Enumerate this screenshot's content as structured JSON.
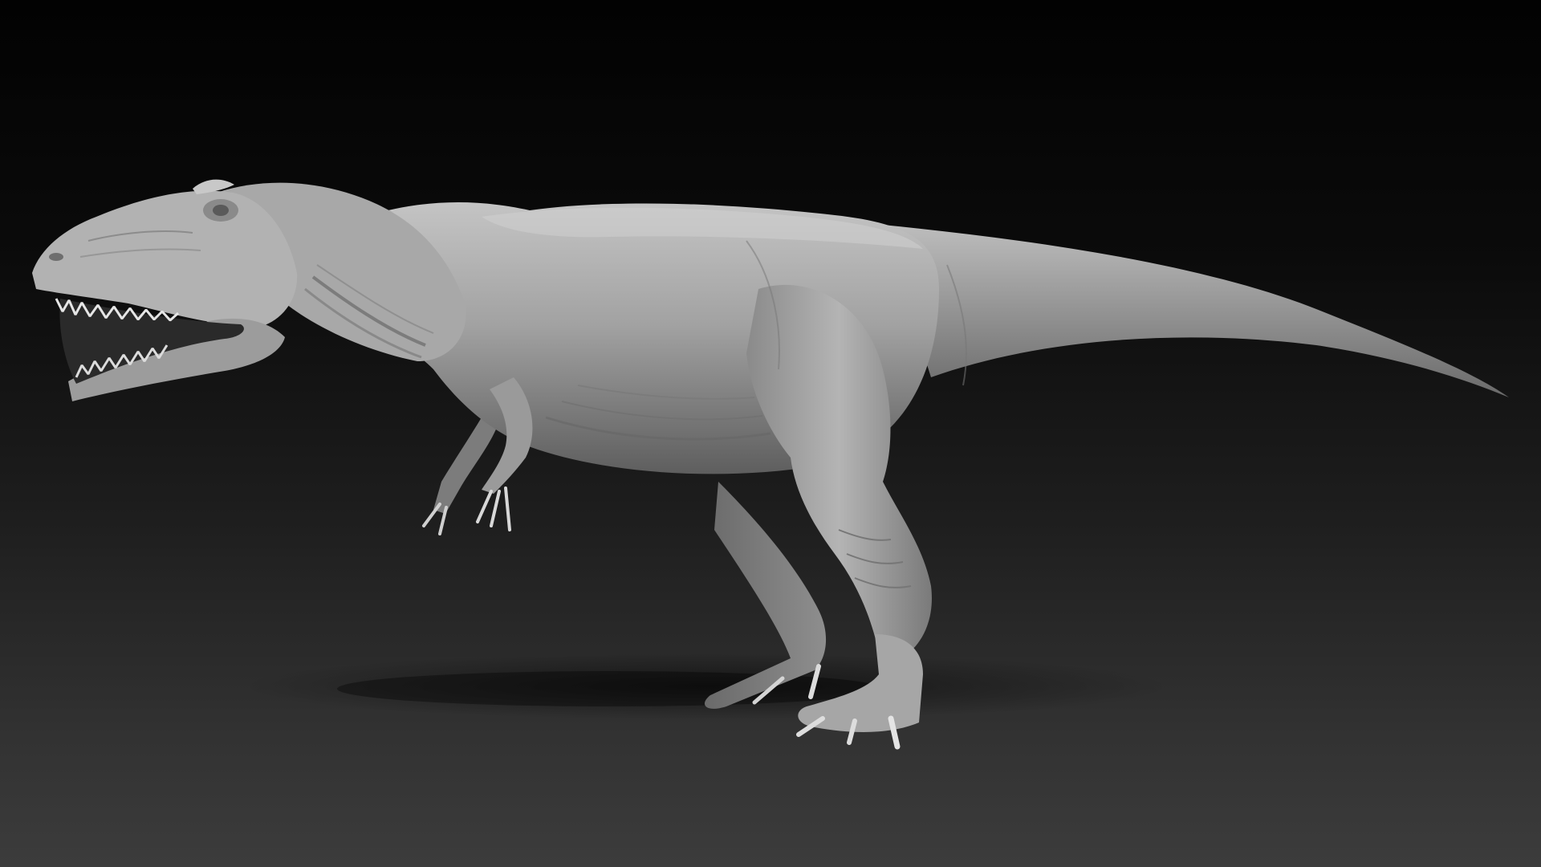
{
  "scene": {
    "subject_icon": "dinosaur-sculpt",
    "colors": {
      "background_top": "#020202",
      "background_bottom": "#3c3c3c",
      "body_light": "#bdbdbd",
      "body_mid": "#8f8f8f",
      "body_dark": "#4a4a4a",
      "claw": "#dcdcdc",
      "mouth_interior": "#2a2a2a"
    }
  }
}
